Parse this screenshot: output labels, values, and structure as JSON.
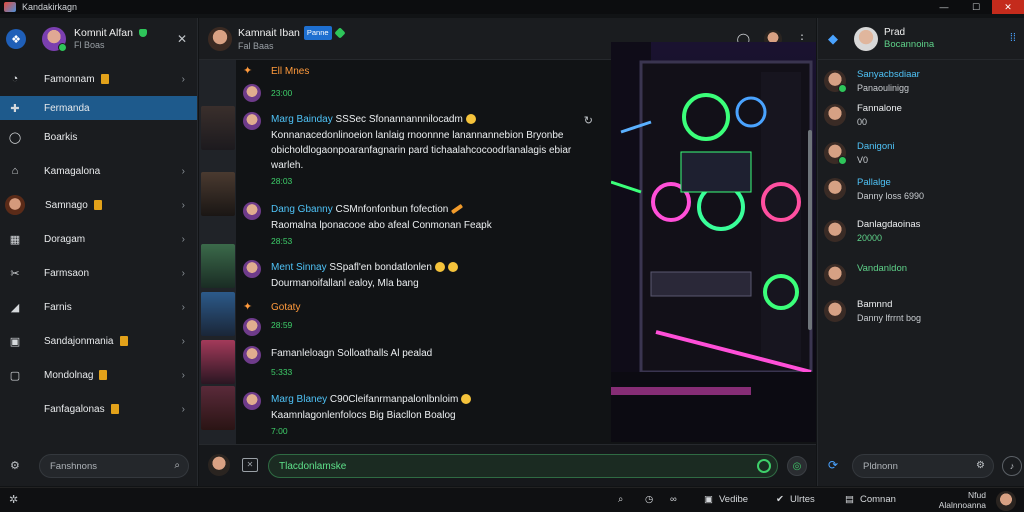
{
  "window": {
    "title": "Kandakirkagn",
    "controls": {
      "minimize": "—",
      "maximize": "☐",
      "close": "✕"
    }
  },
  "sidebar": {
    "user": {
      "name": "Komnit Alfan",
      "status": "Fl Boas"
    },
    "items": [
      {
        "label": "Famonnam",
        "icon": "user-icon",
        "badge": true,
        "chevron": true
      },
      {
        "label": "Fermanda",
        "icon": "puzzle-icon",
        "badge": false,
        "chevron": false,
        "active": true
      },
      {
        "label": "Boarkis",
        "icon": "chat-bubble-icon",
        "badge": false,
        "chevron": false
      },
      {
        "label": "Kamagalona",
        "icon": "home-icon",
        "badge": false,
        "chevron": true
      },
      {
        "label": "Samnago",
        "icon": "avatar",
        "badge": true,
        "chevron": true
      },
      {
        "label": "Doragam",
        "icon": "calendar-icon",
        "badge": false,
        "chevron": true
      },
      {
        "label": "Farmsaon",
        "icon": "tools-icon",
        "badge": false,
        "chevron": true
      },
      {
        "label": "Farnis",
        "icon": "megaphone-icon",
        "badge": false,
        "chevron": true
      },
      {
        "label": "Sandajonmania",
        "icon": "bookmark-icon",
        "badge": true,
        "chevron": true
      },
      {
        "label": "Mondolnag",
        "icon": "box-icon",
        "badge": true,
        "chevron": true
      },
      {
        "label": "Fanfagalonas",
        "icon": "",
        "badge": true,
        "chevron": true
      }
    ],
    "search_placeholder": "Fanshnons"
  },
  "chat": {
    "header": {
      "name": "Kamnait Iban",
      "tag": "Panne",
      "status": "Fal Baas"
    },
    "messages": [
      {
        "author": "Ell Mnes",
        "text": "",
        "time": "23:00",
        "author_color": "orange",
        "lines": []
      },
      {
        "author": "Marg Bainday",
        "text": "SSSec Sfonannannnilocadm",
        "time": "28:03",
        "author_color": "blue",
        "lines": [
          "Konnanacedonlinoeion lanlaig rnoonnne lanannannebion Bryonbe",
          "obicholdlogaonpoaranfagnarin pard tichaalahcocoodrlanalagis ebiar",
          "warleh."
        ]
      },
      {
        "author": "Dang Gbanny",
        "text": "CSMnfonfonbun fofection",
        "time": "28:53",
        "author_color": "blue",
        "lines": [
          "Raomalna lponacooe abo afeal Conmonan Feapk"
        ]
      },
      {
        "author": "Ment Sinnay",
        "text": "SSpafl'en bondatlonlen",
        "time": "",
        "author_color": "blue",
        "lines": [
          "Dourmanoifallanl ealoy, Mla bang"
        ]
      },
      {
        "author": "Gotaty",
        "text": "",
        "time": "28:59",
        "author_color": "orange",
        "lines": []
      },
      {
        "author": "Famanleloagn",
        "text": "Solloathalls Al pealad",
        "time": "5:333",
        "author_color": "white",
        "lines": []
      },
      {
        "author": "Marg Blaney",
        "text": "C90Cleifanrmanpalonlbnloim",
        "time": "7:00",
        "author_color": "blue",
        "lines": [
          "Kaamnlagonlenfolocs Big Biacllon Boalog"
        ]
      }
    ],
    "composer": {
      "value": "Tlacdonlamske"
    }
  },
  "contacts": {
    "header": {
      "name": "Prad",
      "status": "Bocannoina"
    },
    "items": [
      {
        "name": "Sanyacbsdiaar",
        "sub": "Panaoulinigg",
        "name_color": "blue",
        "online": true
      },
      {
        "name": "Fannalone",
        "sub": "00",
        "name_color": "white",
        "online": false
      },
      {
        "name": "Danigoni",
        "sub": "V0",
        "name_color": "blue",
        "online": true
      },
      {
        "name": "Pallalge",
        "sub": "Danny loss 6990",
        "name_color": "blue",
        "online": false
      },
      {
        "name": "Danlagdaoinas",
        "sub": "20000",
        "name_color": "white",
        "online": false
      },
      {
        "name": "Vandanldon",
        "sub": "",
        "name_color": "green",
        "online": false
      },
      {
        "name": "Bamnnd",
        "sub": "Danny lfrrnt bog",
        "name_color": "white",
        "online": false
      }
    ],
    "search_placeholder": "Pldnonn"
  },
  "statusbar": {
    "items": [
      "Vedibe",
      "Ulrtes",
      "Comnan"
    ],
    "user": {
      "name": "Nfud",
      "sub": "Alalnnoanna"
    }
  }
}
